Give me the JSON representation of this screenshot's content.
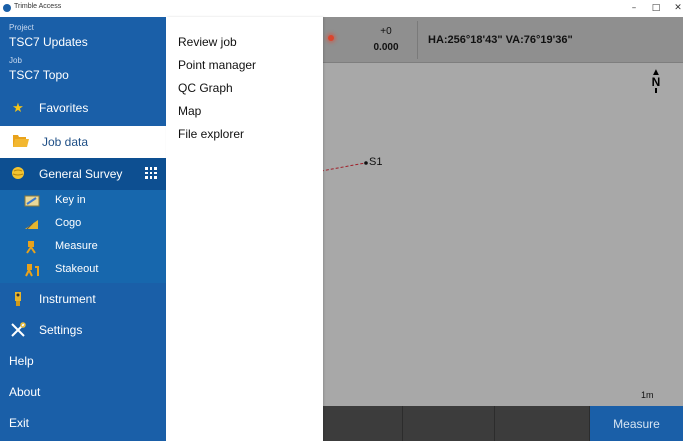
{
  "window": {
    "title": "Trimble Access",
    "min_glyph": "–",
    "max_glyph": "□",
    "close_glyph": "✕"
  },
  "sidebar": {
    "project_label": "Project",
    "project_value": "TSC7 Updates",
    "job_label": "Job",
    "job_value": "TSC7 Topo",
    "favorites": "Favorites",
    "job_data": "Job data",
    "general_survey": "General Survey",
    "sub_items": [
      {
        "label": "Key in",
        "icon": "key-in-icon"
      },
      {
        "label": "Cogo",
        "icon": "cogo-icon"
      },
      {
        "label": "Measure",
        "icon": "measure-icon"
      },
      {
        "label": "Stakeout",
        "icon": "stakeout-icon"
      }
    ],
    "instrument": "Instrument",
    "settings": "Settings",
    "help": "Help",
    "about": "About",
    "exit": "Exit"
  },
  "panel": {
    "items": [
      "Review job",
      "Point manager",
      "QC Graph",
      "Map",
      "File explorer"
    ]
  },
  "map": {
    "offset_top": "+0",
    "offset_bottom": "0.000",
    "angles": "HA:256°18'43\"  VA:76°19'36\"",
    "north_label": "N",
    "point_label": "S1",
    "scale_label": "1m",
    "measure_button": "Measure"
  },
  "colors": {
    "sidebar_blue": "#1a5fa8",
    "active_blue": "#0d4f91",
    "map_gray": "#a8a8a8",
    "accent_yellow": "#f5c518"
  }
}
